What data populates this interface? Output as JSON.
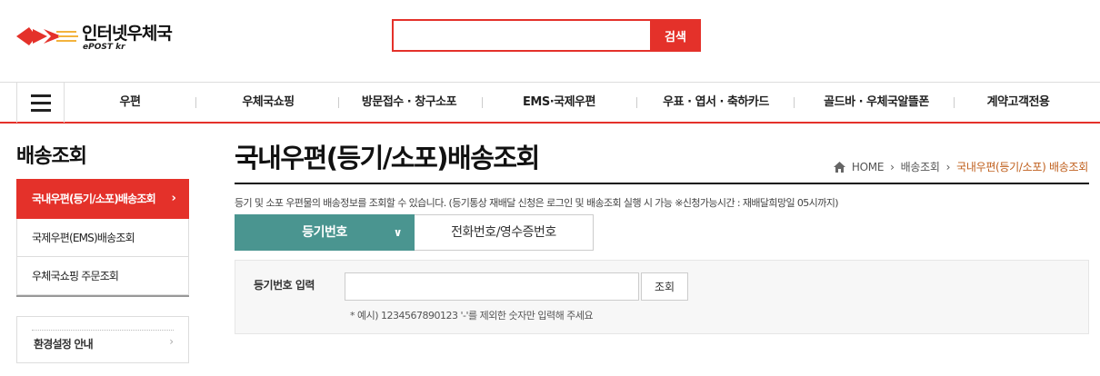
{
  "header": {
    "logo_text": "인터넷우체국",
    "logo_sub": "ePOST kr",
    "search_placeholder": "",
    "search_button": "검색"
  },
  "gnb": {
    "items": [
      "우편",
      "우체국쇼핑",
      "방문접수 · 창구소포",
      "EMS·국제우편",
      "우표 · 엽서 · 축하카드",
      "골드바 · 우체국알뜰폰",
      "계약고객전용"
    ]
  },
  "lnb": {
    "title": "배송조회",
    "items": [
      {
        "label": "국내우편(등기/소포)배송조회",
        "active": true
      },
      {
        "label": "국제우편(EMS)배송조회",
        "active": false
      },
      {
        "label": "우체국쇼핑 주문조회",
        "active": false
      }
    ],
    "env_label": "환경설정 안내"
  },
  "content": {
    "title": "국내우편(등기/소포)배송조회",
    "breadcrumb": [
      "HOME",
      "배송조회",
      "국내우편(등기/소포) 배송조회"
    ],
    "description": "등기 및 소포 우편물의 배송정보를 조회할 수 있습니다. (등기통상 재배달 신청은 로그인 및 배송조회 실행 시 가능 ※신청가능시간 : 재배달희망일 05시까지)",
    "tabs": [
      {
        "label": "등기번호",
        "active": true
      },
      {
        "label": "전화번호/영수증번호",
        "active": false
      }
    ],
    "form": {
      "label": "등기번호 입력",
      "input_value": "",
      "button": "조회",
      "hint": "* 예시) 1234567890123 '-'를 제외한 숫자만 입력해 주세요"
    }
  },
  "colors": {
    "brand_red": "#e4312a",
    "tab_teal": "#4a9590",
    "breadcrumb_current": "#c0601e"
  }
}
